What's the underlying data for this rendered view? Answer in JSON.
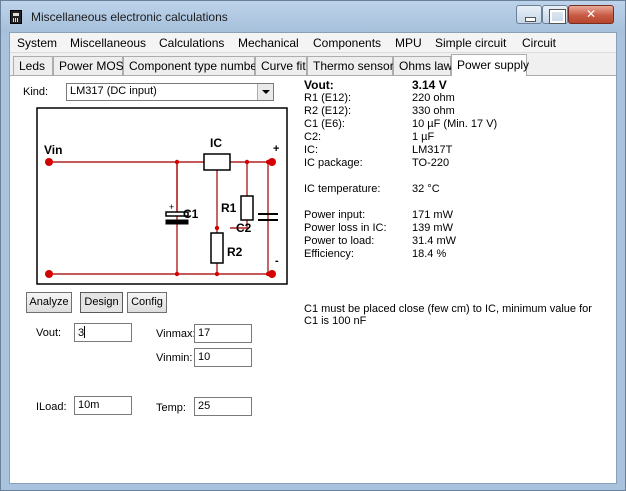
{
  "window": {
    "title": "Miscellaneous electronic calculations"
  },
  "menu": [
    "System",
    "Miscellaneous",
    "Calculations",
    "Mechanical",
    "Components",
    "MPU",
    "Simple circuit",
    "Circuit"
  ],
  "tabs": [
    "Leds",
    "Power MOS",
    "Component type numbers",
    "Curve fit",
    "Thermo sensors",
    "Ohms law",
    "Power supply"
  ],
  "active_tab": "Power supply",
  "kind": {
    "label": "Kind:",
    "value": "LM317 (DC input)"
  },
  "circuit": {
    "vin": "Vin",
    "ic": "IC",
    "r1": "R1",
    "r2": "R2",
    "c1": "C1",
    "c2": "C2",
    "plus": "+",
    "minus": "-",
    "cap_plus": "+",
    "wire_color": "#b22222",
    "node_color": "#d40000"
  },
  "buttons": {
    "analyze": "Analyze",
    "design": "Design",
    "config": "Config"
  },
  "inputs": {
    "vout": {
      "label": "Vout:",
      "value": "3"
    },
    "vinmax": {
      "label": "Vinmax:",
      "value": "17"
    },
    "vinmin": {
      "label": "Vinmin:",
      "value": "10"
    },
    "iload": {
      "label": "ILoad:",
      "value": "10m"
    },
    "temp": {
      "label": "Temp:",
      "value": "25"
    }
  },
  "results": {
    "vout": {
      "label": "Vout:",
      "value": "3.14 V"
    },
    "r1": {
      "label": "R1 (E12):",
      "value": "220 ohm"
    },
    "r2": {
      "label": "R2 (E12):",
      "value": "330 ohm"
    },
    "c1": {
      "label": "C1 (E6):",
      "value": "10 µF   (Min. 17 V)"
    },
    "c2": {
      "label": "C2:",
      "value": "1 µF"
    },
    "ic": {
      "label": "IC:",
      "value": "LM317T"
    },
    "ic_package": {
      "label": "IC package:",
      "value": "TO-220"
    },
    "ic_temperature": {
      "label": "IC temperature:",
      "value": "32 °C"
    },
    "power_input": {
      "label": "Power input:",
      "value": "171 mW"
    },
    "power_loss": {
      "label": "Power loss in IC:",
      "value": "139 mW"
    },
    "power_load": {
      "label": "Power to load:",
      "value": "31.4 mW"
    },
    "efficiency": {
      "label": "Efficiency:",
      "value": "18.4 %"
    }
  },
  "note": "C1 must be placed close (few cm) to IC, minimum value for C1 is 100 nF"
}
